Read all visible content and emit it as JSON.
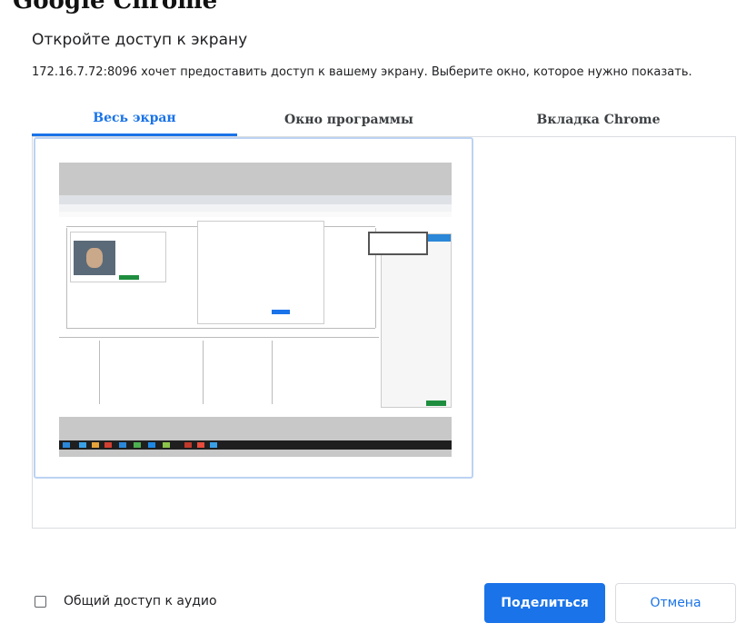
{
  "background": {
    "page_heading": "Google Chrome"
  },
  "dialog": {
    "title": "Откройте доступ к экрану",
    "description": "172.16.7.72:8096 хочет предоставить доступ к вашему экрану. Выберите окно, которое нужно показать.",
    "tabs": [
      {
        "label": "Весь экран",
        "active": true
      },
      {
        "label": "Окно программы",
        "active": false
      },
      {
        "label": "Вкладка Chrome",
        "active": false
      }
    ],
    "audio_checkbox": {
      "label": "Общий доступ к аудио",
      "checked": false
    },
    "share_button": "Поделиться",
    "cancel_button": "Отмена"
  },
  "colors": {
    "accent": "#1a73e8",
    "selection_border": "#bcd3f3",
    "text": "#202124",
    "divider": "#dadce0"
  }
}
